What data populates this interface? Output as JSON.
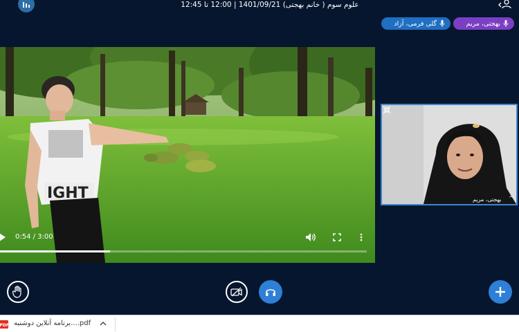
{
  "header": {
    "title": "علوم سوم ( خانم بهجتی) 1401/09/21 | 12:00 تا 12:45"
  },
  "participants": [
    {
      "label": "بهجتی، مریم",
      "color": "#7b3fc3"
    },
    {
      "label": "گلی فرمی، آزاد",
      "color": "#1f6fc2"
    }
  ],
  "video": {
    "current_time": "0:54 / 3:00",
    "progress": 0.3,
    "shirt_text": "IGHT"
  },
  "webcam": {
    "name": "بهجتی، مریم"
  },
  "download": {
    "file_name": "برنامه آنلاین دوشنبه....pdf"
  },
  "colors": {
    "background": "#06162e",
    "accent": "#2e7fd6",
    "webcam_border": "#3f86d1"
  }
}
